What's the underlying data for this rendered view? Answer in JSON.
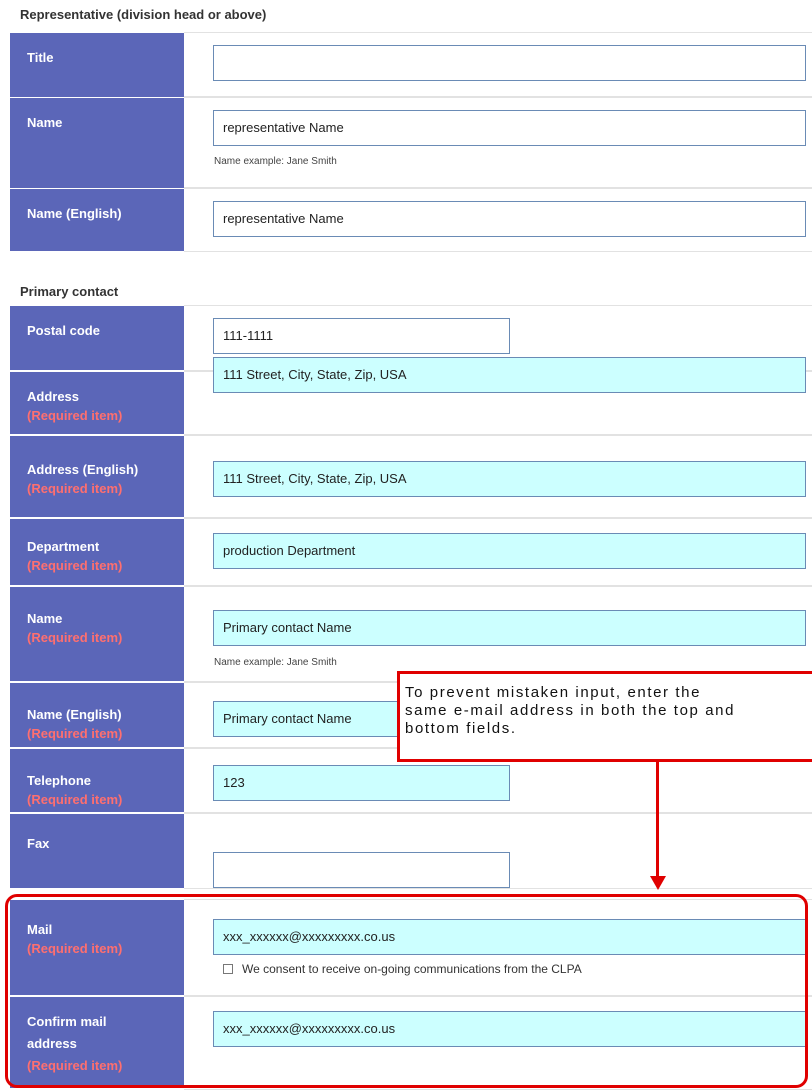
{
  "sections": {
    "representative": "Representative (division head or above)",
    "primary": "Primary contact"
  },
  "required_label": "(Required item)",
  "representative": {
    "title": {
      "label": "Title",
      "value": ""
    },
    "name": {
      "label": "Name",
      "value": "representative Name",
      "hint": "Name example: Jane Smith"
    },
    "name_en": {
      "label": "Name (English)",
      "value": "representative Name"
    }
  },
  "primary": {
    "postal": {
      "label": "Postal code",
      "value": "111-1111"
    },
    "address": {
      "label": "Address",
      "value": "111 Street, City, State, Zip, USA"
    },
    "address_en": {
      "label": "Address (English)",
      "value": "111 Street, City, State, Zip, USA"
    },
    "department": {
      "label": "Department",
      "value": "production Department"
    },
    "name": {
      "label": "Name",
      "value": "Primary contact Name",
      "hint": "Name example: Jane Smith"
    },
    "name_en": {
      "label": "Name (English)",
      "value": "Primary contact Name"
    },
    "telephone": {
      "label": "Telephone",
      "value": "123"
    },
    "fax": {
      "label": "Fax",
      "value": ""
    },
    "mail": {
      "label": "Mail",
      "value": "xxx_xxxxxx@xxxxxxxxx.co.us",
      "consent": "We consent to receive on-going communications from the CLPA"
    },
    "confirm_mail": {
      "label_line1": "Confirm mail",
      "label_line2": "address",
      "value": "xxx_xxxxxx@xxxxxxxxx.co.us"
    }
  },
  "callout": {
    "line1": "To prevent mistaken input, enter the",
    "line2": "same e-mail address in both the top and",
    "line3": "bottom fields."
  },
  "colors": {
    "label_bg": "#5b66b8",
    "required_text": "#ff6f6f",
    "required_field_bg": "#ccffff",
    "callout_red": "#e00000"
  }
}
